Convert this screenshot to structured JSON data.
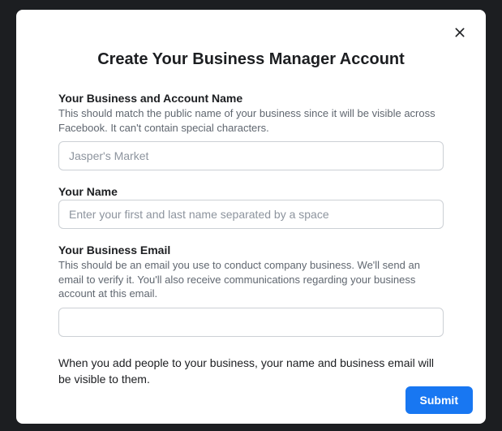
{
  "modal": {
    "title": "Create Your Business Manager Account",
    "fields": {
      "business_name": {
        "label": "Your Business and Account Name",
        "help": "This should match the public name of your business since it will be visible across Facebook. It can't contain special characters.",
        "placeholder": "Jasper's Market",
        "value": ""
      },
      "your_name": {
        "label": "Your Name",
        "help": "",
        "placeholder": "Enter your first and last name separated by a space",
        "value": ""
      },
      "business_email": {
        "label": "Your Business Email",
        "help": "This should be an email you use to conduct company business. We'll send an email to verify it. You'll also receive communications regarding your business account at this email.",
        "placeholder": "",
        "value": ""
      }
    },
    "note": "When you add people to your business, your name and business email will be visible to them.",
    "submit_label": "Submit"
  }
}
